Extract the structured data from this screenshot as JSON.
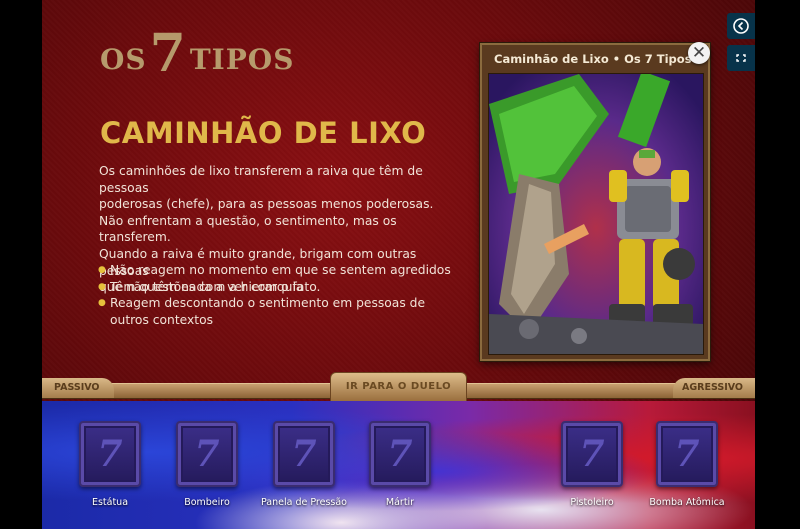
{
  "logo": {
    "os": "OS",
    "seven": "7",
    "tipos": "TIPOS"
  },
  "page_title": "CAMINHÃO DE LIXO",
  "description": [
    "Os caminhões de lixo transferem a raiva que têm de pessoas",
    "poderosas (chefe), para as pessoas menos poderosas.",
    "Não enfrentam a questão, o sentimento, mas os transferem.",
    "Quando a raiva é muito grande, brigam com outras pessoas",
    "que não têm nada a ver com o fato."
  ],
  "bullets": [
    "Não reagem no momento em que se sentem agredidos",
    "Têm questões com a hierarquia",
    "Reagem descontando o sentimento em pessoas de outros contextos"
  ],
  "card": {
    "header": "Caminhão de Lixo  •  Os 7 Tipos"
  },
  "controls": {
    "close": "✕",
    "back": "❮",
    "fullscreen": "⛶"
  },
  "bar": {
    "passivo": "PASSIVO",
    "duelo": "IR PARA O DUELO",
    "agressivo": "AGRESSIVO"
  },
  "deck": [
    {
      "name": "Estátua",
      "symbol": "7"
    },
    {
      "name": "Bombeiro",
      "symbol": "7"
    },
    {
      "name": "Panela de Pressão",
      "symbol": "7"
    },
    {
      "name": "Mártir",
      "symbol": "7"
    },
    {
      "name": "Pistoleiro",
      "symbol": "7"
    },
    {
      "name": "Bomba Atômica",
      "symbol": "7"
    }
  ],
  "colors": {
    "background": "#6a0a0c",
    "title": "#e0b84a",
    "logo": "#b69a6c",
    "bullet": "#e6c13c",
    "side_button": "#07334a"
  }
}
